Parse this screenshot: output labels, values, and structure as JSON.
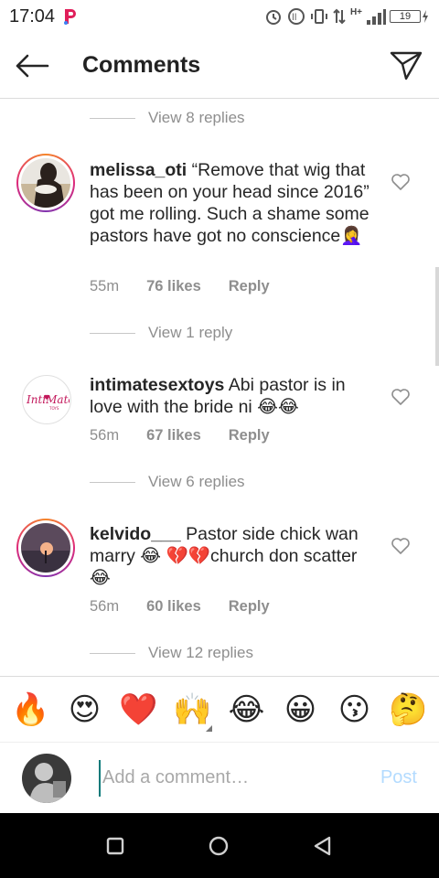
{
  "status_bar": {
    "time": "17:04",
    "signal_label": "H+",
    "battery": "19"
  },
  "header": {
    "title": "Comments"
  },
  "comments": [
    {
      "view_replies": "View 8 replies"
    },
    {
      "username": "melissa_oti",
      "text": "“Remove that wig that has been on your head since 2016” got me rolling. Such a shame some pastors have got no conscience🤦‍♀️",
      "time": "55m",
      "likes": "76 likes",
      "reply": "Reply",
      "view_replies": "View 1 reply"
    },
    {
      "username": "intimatesextoys",
      "text": "Abi pastor is in love with the bride ni 😂😂",
      "time": "56m",
      "likes": "67 likes",
      "reply": "Reply",
      "avatar_logo": "IntiMate",
      "view_replies": "View 6 replies"
    },
    {
      "username": "kelvido___",
      "text": "Pastor side chick wan marry 😂 💔💔church don scatter 😂",
      "time": "56m",
      "likes": "60 likes",
      "reply": "Reply",
      "view_replies": "View 12 replies"
    }
  ],
  "emoji_bar": [
    "🔥",
    "😍",
    "❤️",
    "🙌",
    "😂",
    "😀",
    "😗",
    "🤔"
  ],
  "input": {
    "placeholder": "Add a comment…",
    "post_label": "Post"
  },
  "colors": {
    "accent_post": "#b3dbff",
    "story_ring": "#dd2a7b",
    "muted": "#8e8e8e"
  }
}
